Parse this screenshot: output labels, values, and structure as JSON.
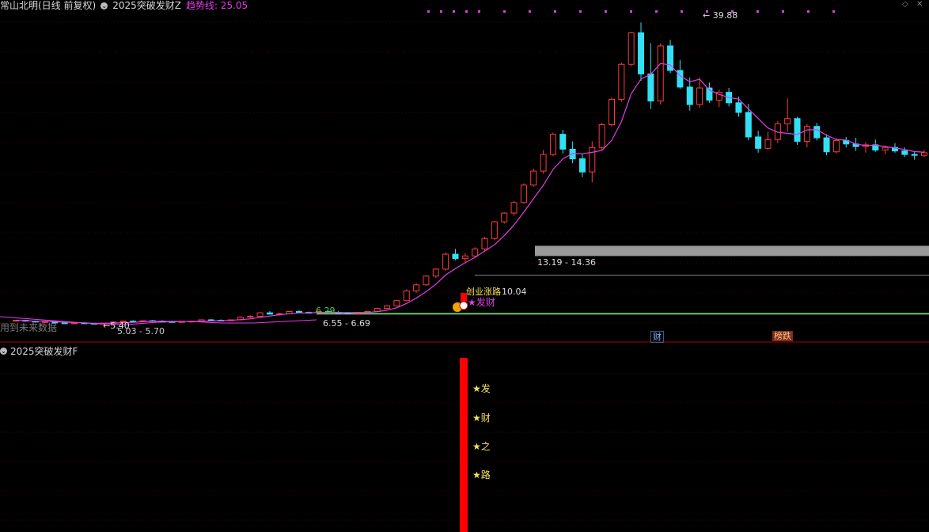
{
  "header": {
    "title": "常山北明(日线 前复权)",
    "indicator_name": "2025突破发财Z",
    "trend_label": "趋势线: 25.05"
  },
  "sub_panel": {
    "title": "2025突破发财F",
    "stars": [
      "★发",
      "★财",
      "★之",
      "★路"
    ]
  },
  "annotations": {
    "high": "39.88",
    "low": "5.40",
    "low_range": "5.03 - 5.70",
    "box_range": "13.19 - 14.36",
    "mid_range": "6.55 - 6.69",
    "green_price": "6.29",
    "signal_price": "10.04",
    "signal_text": "★发财",
    "signal_small": "创业涨路",
    "future_data": "用到未来数据",
    "tag_cai": "财",
    "tag_fall": "榜跌"
  },
  "colors": {
    "up": "#ff3b3b",
    "down": "#31e0f5",
    "ma": "#e23ee6",
    "grid": "#4a0000",
    "divider": "#aa0000",
    "box": "#9a9a9a",
    "signal_bar": "#ff0000",
    "star_text": "#f6e35a"
  },
  "chart_data": {
    "type": "candlestick",
    "ylim": [
      4,
      41
    ],
    "candles": [
      [
        5.8,
        5.9,
        5.7,
        5.85
      ],
      [
        5.85,
        5.9,
        5.7,
        5.75
      ],
      [
        5.75,
        5.8,
        5.6,
        5.65
      ],
      [
        5.65,
        5.75,
        5.55,
        5.7
      ],
      [
        5.7,
        5.75,
        5.5,
        5.55
      ],
      [
        5.55,
        5.6,
        5.45,
        5.5
      ],
      [
        5.5,
        5.6,
        5.4,
        5.55
      ],
      [
        5.55,
        5.65,
        5.45,
        5.5
      ],
      [
        5.5,
        5.55,
        5.4,
        5.45
      ],
      [
        5.45,
        5.55,
        5.4,
        5.5
      ],
      [
        5.5,
        5.7,
        5.45,
        5.65
      ],
      [
        5.65,
        5.8,
        5.6,
        5.75
      ],
      [
        5.75,
        5.85,
        5.65,
        5.7
      ],
      [
        5.7,
        5.85,
        5.65,
        5.8
      ],
      [
        5.8,
        5.9,
        5.7,
        5.75
      ],
      [
        5.75,
        5.85,
        5.65,
        5.7
      ],
      [
        5.7,
        5.8,
        5.6,
        5.65
      ],
      [
        5.65,
        5.75,
        5.6,
        5.7
      ],
      [
        5.7,
        5.8,
        5.6,
        5.75
      ],
      [
        5.75,
        5.95,
        5.7,
        5.9
      ],
      [
        5.9,
        6.0,
        5.8,
        5.85
      ],
      [
        5.85,
        5.95,
        5.75,
        5.8
      ],
      [
        5.8,
        5.95,
        5.75,
        5.9
      ],
      [
        5.9,
        6.3,
        5.85,
        6.2
      ],
      [
        6.2,
        6.4,
        6.1,
        6.3
      ],
      [
        6.3,
        6.8,
        6.25,
        6.7
      ],
      [
        6.7,
        6.9,
        6.5,
        6.55
      ],
      [
        6.55,
        6.7,
        6.4,
        6.6
      ],
      [
        6.6,
        6.9,
        6.55,
        6.85
      ],
      [
        6.85,
        7.0,
        6.7,
        6.75
      ],
      [
        6.75,
        6.85,
        6.6,
        6.7
      ],
      [
        6.7,
        6.9,
        6.65,
        6.85
      ],
      [
        6.85,
        6.95,
        6.7,
        6.75
      ],
      [
        6.75,
        6.9,
        6.6,
        6.7
      ],
      [
        6.7,
        6.8,
        6.55,
        6.65
      ],
      [
        6.65,
        6.8,
        6.6,
        6.75
      ],
      [
        6.75,
        6.9,
        6.65,
        6.85
      ],
      [
        6.85,
        7.3,
        6.8,
        7.2
      ],
      [
        7.2,
        7.6,
        7.1,
        7.5
      ],
      [
        7.5,
        8.2,
        7.45,
        8.1
      ],
      [
        8.1,
        9.4,
        8.0,
        9.2
      ],
      [
        9.2,
        10.1,
        9.0,
        9.9
      ],
      [
        9.9,
        11.0,
        9.8,
        10.9
      ],
      [
        10.9,
        11.8,
        10.7,
        11.7
      ],
      [
        11.7,
        13.6,
        11.5,
        13.4
      ],
      [
        13.4,
        14.0,
        12.7,
        12.9
      ],
      [
        12.9,
        13.5,
        12.5,
        13.2
      ],
      [
        13.2,
        14.2,
        13.0,
        14.0
      ],
      [
        14.0,
        15.4,
        13.8,
        15.2
      ],
      [
        15.2,
        17.2,
        15.0,
        17.1
      ],
      [
        17.1,
        18.2,
        16.9,
        18.1
      ],
      [
        18.1,
        19.5,
        17.8,
        19.3
      ],
      [
        19.3,
        21.5,
        19.2,
        21.3
      ],
      [
        21.3,
        23.2,
        21.1,
        22.9
      ],
      [
        22.9,
        25.3,
        22.6,
        24.8
      ],
      [
        24.8,
        27.3,
        24.6,
        27.1
      ],
      [
        27.1,
        27.6,
        24.9,
        25.4
      ],
      [
        25.4,
        26.3,
        23.8,
        24.3
      ],
      [
        24.3,
        24.9,
        22.2,
        22.8
      ],
      [
        22.8,
        26.3,
        21.6,
        25.6
      ],
      [
        25.6,
        28.4,
        25.3,
        28.2
      ],
      [
        28.2,
        31.3,
        28.0,
        31.1
      ],
      [
        31.1,
        35.3,
        30.8,
        35.1
      ],
      [
        35.1,
        38.8,
        34.9,
        38.7
      ],
      [
        38.7,
        39.88,
        33.2,
        34.0
      ],
      [
        34.0,
        37.5,
        30.0,
        30.9
      ],
      [
        30.9,
        37.5,
        30.5,
        37.2
      ],
      [
        37.2,
        37.9,
        34.1,
        34.4
      ],
      [
        34.4,
        35.6,
        32.3,
        32.5
      ],
      [
        32.5,
        33.6,
        29.8,
        30.5
      ],
      [
        30.5,
        33.6,
        30.1,
        32.4
      ],
      [
        32.4,
        33.0,
        30.7,
        31.0
      ],
      [
        31.0,
        32.2,
        30.2,
        31.9
      ],
      [
        31.9,
        32.4,
        30.3,
        30.7
      ],
      [
        30.7,
        31.4,
        29.1,
        29.6
      ],
      [
        29.6,
        30.6,
        26.4,
        26.8
      ],
      [
        26.8,
        27.5,
        25.0,
        25.5
      ],
      [
        25.5,
        27.4,
        25.3,
        26.5
      ],
      [
        26.5,
        28.6,
        26.1,
        28.3
      ],
      [
        28.3,
        31.2,
        27.4,
        28.9
      ],
      [
        28.9,
        29.1,
        25.9,
        26.3
      ],
      [
        26.3,
        28.3,
        25.6,
        28.0
      ],
      [
        28.0,
        28.4,
        26.4,
        26.7
      ],
      [
        26.7,
        27.1,
        24.7,
        25.1
      ],
      [
        25.1,
        26.7,
        24.9,
        26.4
      ],
      [
        26.4,
        26.8,
        25.6,
        26.0
      ],
      [
        26.0,
        26.7,
        25.2,
        25.7
      ],
      [
        25.7,
        26.2,
        25.0,
        25.9
      ],
      [
        25.9,
        26.5,
        25.1,
        25.3
      ],
      [
        25.3,
        25.8,
        24.8,
        25.6
      ],
      [
        25.6,
        26.1,
        25.0,
        25.2
      ],
      [
        25.2,
        25.6,
        24.5,
        24.8
      ],
      [
        24.8,
        25.1,
        24.2,
        24.7
      ],
      [
        24.7,
        25.3,
        24.5,
        25.0
      ]
    ]
  }
}
